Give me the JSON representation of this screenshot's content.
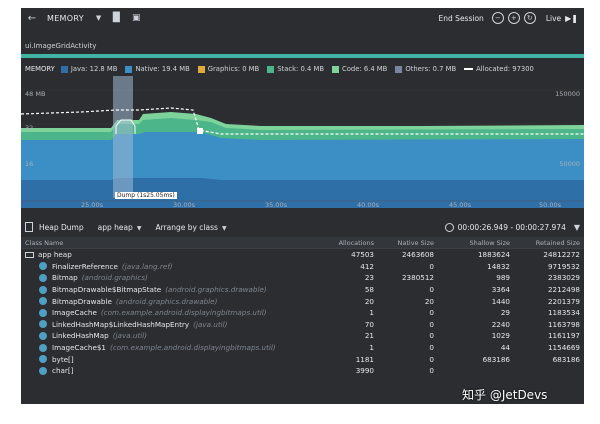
{
  "toolbar": {
    "title": "MEMORY",
    "end_session": "End Session",
    "live": "Live"
  },
  "activity_label": "ui.ImageGridActivity",
  "legend": {
    "title": "MEMORY",
    "items": [
      {
        "label": "Java: 12.8 MB",
        "color": "#2f6fa8"
      },
      {
        "label": "Native: 19.4 MB",
        "color": "#3b8fc5"
      },
      {
        "label": "Graphics: 0 MB",
        "color": "#e0a93b"
      },
      {
        "label": "Stack: 0.4 MB",
        "color": "#4db58a"
      },
      {
        "label": "Code: 6.4 MB",
        "color": "#7ed39a"
      },
      {
        "label": "Others: 0.7 MB",
        "color": "#7a86a0"
      }
    ],
    "allocated": "Allocated: 97300"
  },
  "chart_data": {
    "type": "area",
    "y_left_ticks": [
      "48 MB",
      "32",
      "16"
    ],
    "y_right_ticks": [
      "150000",
      "50000"
    ],
    "x_ticks": [
      "25.00s",
      "30.00s",
      "35.00s",
      "40.00s",
      "45.00s",
      "50.00s"
    ],
    "dump_label": "Dump (1s25.05ms)"
  },
  "heap": {
    "title": "Heap Dump",
    "heap_select": "app heap",
    "arrange": "Arrange by class",
    "time_range": "00:00:26.949 - 00:00:27.974"
  },
  "columns": [
    "Class Name",
    "Allocations",
    "Native Size",
    "Shallow Size",
    "Retained Size"
  ],
  "root": {
    "name": "app heap",
    "alloc": "47503",
    "native": "2463608",
    "shallow": "1883624",
    "retained": "24812272"
  },
  "rows": [
    {
      "name": "FinalizerReference",
      "pkg": "(java.lang.ref)",
      "alloc": "412",
      "native": "0",
      "shallow": "14832",
      "retained": "9719532"
    },
    {
      "name": "Bitmap",
      "pkg": "(android.graphics)",
      "alloc": "23",
      "native": "2380512",
      "shallow": "989",
      "retained": "2383029"
    },
    {
      "name": "BitmapDrawable$BitmapState",
      "pkg": "(android.graphics.drawable)",
      "alloc": "58",
      "native": "0",
      "shallow": "3364",
      "retained": "2212498"
    },
    {
      "name": "BitmapDrawable",
      "pkg": "(android.graphics.drawable)",
      "alloc": "20",
      "native": "20",
      "shallow": "1440",
      "retained": "2201379"
    },
    {
      "name": "ImageCache",
      "pkg": "(com.example.android.displayingbitmaps.util)",
      "alloc": "1",
      "native": "0",
      "shallow": "29",
      "retained": "1183534"
    },
    {
      "name": "LinkedHashMap$LinkedHashMapEntry",
      "pkg": "(java.util)",
      "alloc": "70",
      "native": "0",
      "shallow": "2240",
      "retained": "1163798"
    },
    {
      "name": "LinkedHashMap",
      "pkg": "(java.util)",
      "alloc": "21",
      "native": "0",
      "shallow": "1029",
      "retained": "1161197"
    },
    {
      "name": "ImageCache$1",
      "pkg": "(com.example.android.displayingbitmaps.util)",
      "alloc": "1",
      "native": "0",
      "shallow": "44",
      "retained": "1154669"
    },
    {
      "name": "byte[]",
      "pkg": "",
      "alloc": "1181",
      "native": "0",
      "shallow": "683186",
      "retained": "683186"
    },
    {
      "name": "char[]",
      "pkg": "",
      "alloc": "3990",
      "native": "0",
      "shallow": "",
      "retained": ""
    }
  ],
  "watermark": "知乎 @JetDevs"
}
